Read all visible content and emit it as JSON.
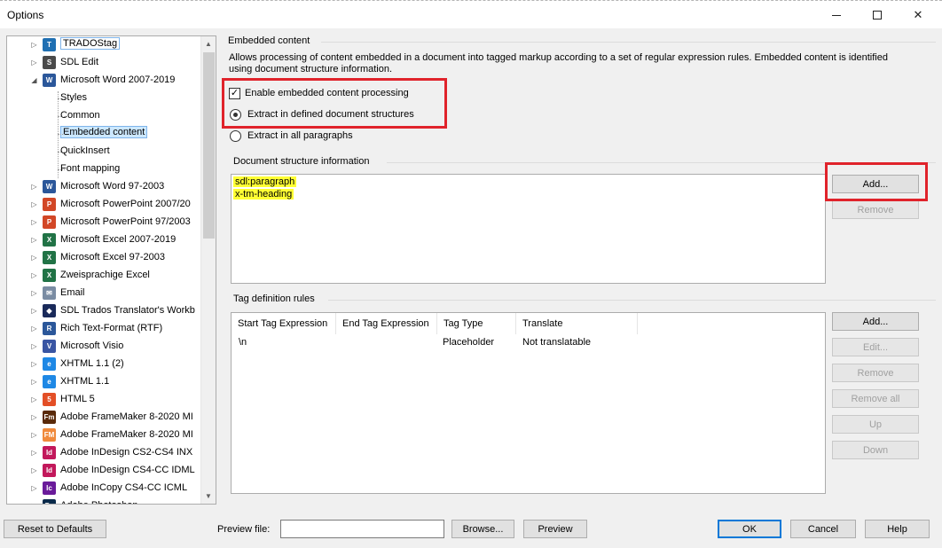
{
  "window": {
    "title": "Options",
    "minimize": "–",
    "maximize": "□",
    "close": "✕"
  },
  "tree": {
    "items": [
      {
        "label": "TRADOStag",
        "icon": "tradostag-icon",
        "icon_text": "T",
        "icon_color": "#1f6fb2",
        "level": 1,
        "expander": "▷"
      },
      {
        "label": "SDL Edit",
        "icon": "sdl-edit-icon",
        "icon_text": "S",
        "icon_color": "#4a4a4a",
        "level": 1,
        "expander": "▷"
      },
      {
        "label": "Microsoft Word 2007-2019",
        "icon": "word-icon",
        "icon_text": "W",
        "icon_color": "#2b579a",
        "level": 1,
        "expander": "◢"
      },
      {
        "label": "Styles",
        "level": 2
      },
      {
        "label": "Common",
        "level": 2
      },
      {
        "label": "Embedded content",
        "level": 2
      },
      {
        "label": "QuickInsert",
        "level": 2
      },
      {
        "label": "Font mapping",
        "level": 2
      },
      {
        "label": "Microsoft Word 97-2003",
        "icon": "word-icon",
        "icon_text": "W",
        "icon_color": "#2b579a",
        "level": 1,
        "expander": "▷"
      },
      {
        "label": "Microsoft PowerPoint 2007/20",
        "icon": "powerpoint-icon",
        "icon_text": "P",
        "icon_color": "#d24726",
        "level": 1,
        "expander": "▷"
      },
      {
        "label": "Microsoft PowerPoint 97/2003",
        "icon": "powerpoint-icon",
        "icon_text": "P",
        "icon_color": "#d24726",
        "level": 1,
        "expander": "▷"
      },
      {
        "label": "Microsoft Excel 2007-2019",
        "icon": "excel-icon",
        "icon_text": "X",
        "icon_color": "#217346",
        "level": 1,
        "expander": "▷"
      },
      {
        "label": "Microsoft Excel 97-2003",
        "icon": "excel-icon",
        "icon_text": "X",
        "icon_color": "#217346",
        "level": 1,
        "expander": "▷"
      },
      {
        "label": "Zweisprachige Excel",
        "icon": "excel-icon",
        "icon_text": "X",
        "icon_color": "#217346",
        "level": 1,
        "expander": "▷"
      },
      {
        "label": "Email",
        "icon": "email-icon",
        "icon_text": "✉",
        "icon_color": "#7a8ca3",
        "level": 1,
        "expander": "▷"
      },
      {
        "label": "SDL Trados Translator's Workb",
        "icon": "trados-workbench-icon",
        "icon_text": "◆",
        "icon_color": "#1a2a5a",
        "level": 1,
        "expander": "▷"
      },
      {
        "label": "Rich Text-Format (RTF)",
        "icon": "rtf-icon",
        "icon_text": "R",
        "icon_color": "#2b579a",
        "level": 1,
        "expander": "▷"
      },
      {
        "label": "Microsoft Visio",
        "icon": "visio-icon",
        "icon_text": "V",
        "icon_color": "#3955a3",
        "level": 1,
        "expander": "▷"
      },
      {
        "label": "XHTML 1.1 (2)",
        "icon": "xhtml-icon",
        "icon_text": "e",
        "icon_color": "#1e88e5",
        "level": 1,
        "expander": "▷"
      },
      {
        "label": "XHTML 1.1",
        "icon": "xhtml-icon",
        "icon_text": "e",
        "icon_color": "#1e88e5",
        "level": 1,
        "expander": "▷"
      },
      {
        "label": "HTML 5",
        "icon": "html5-icon",
        "icon_text": "5",
        "icon_color": "#e34f26",
        "level": 1,
        "expander": "▷"
      },
      {
        "label": "Adobe FrameMaker 8-2020 MI",
        "icon": "framemaker-icon",
        "icon_text": "Fm",
        "icon_color": "#5a2a0a",
        "level": 1,
        "expander": "▷"
      },
      {
        "label": "Adobe FrameMaker 8-2020 MI",
        "icon": "framemaker-icon",
        "icon_text": "FM",
        "icon_color": "#f08a3c",
        "level": 1,
        "expander": "▷"
      },
      {
        "label": "Adobe InDesign CS2-CS4 INX",
        "icon": "indesign-icon",
        "icon_text": "Id",
        "icon_color": "#c2185b",
        "level": 1,
        "expander": "▷"
      },
      {
        "label": "Adobe InDesign CS4-CC IDML",
        "icon": "indesign-icon",
        "icon_text": "Id",
        "icon_color": "#c2185b",
        "level": 1,
        "expander": "▷"
      },
      {
        "label": "Adobe InCopy CS4-CC ICML",
        "icon": "incopy-icon",
        "icon_text": "Ic",
        "icon_color": "#6a1b9a",
        "level": 1,
        "expander": "▷"
      },
      {
        "label": "Adobe Photoshop",
        "icon": "photoshop-icon",
        "icon_text": "Ps",
        "icon_color": "#0a2a4a",
        "level": 1,
        "expander": "▷"
      }
    ]
  },
  "embedded": {
    "section_title": "Embedded content",
    "description": "Allows processing of content embedded in a document into tagged markup according to a set of regular expression rules. Embedded content is identified using document structure information.",
    "enable_label": "Enable embedded content processing",
    "enable_checked": "✓",
    "extract_defined_label": "Extract in defined document structures",
    "extract_all_label": "Extract in all paragraphs"
  },
  "doc_structure": {
    "section_title": "Document structure information",
    "items": [
      "sdl:paragraph",
      "x-tm-heading"
    ],
    "add_label": "Add...",
    "remove_label": "Remove"
  },
  "tag_rules": {
    "section_title": "Tag definition rules",
    "columns": [
      "Start Tag Expression",
      "End Tag Expression",
      "Tag Type",
      "Translate"
    ],
    "rows": [
      [
        "\\n",
        "",
        "Placeholder",
        "Not translatable"
      ]
    ],
    "add_label": "Add...",
    "edit_label": "Edit...",
    "remove_label": "Remove",
    "remove_all_label": "Remove all",
    "up_label": "Up",
    "down_label": "Down"
  },
  "footer": {
    "reset_label": "Reset to Defaults",
    "preview_file_label": "Preview file:",
    "preview_file_value": "",
    "browse_label": "Browse...",
    "preview_label": "Preview",
    "ok_label": "OK",
    "cancel_label": "Cancel",
    "help_label": "Help"
  },
  "colors": {
    "highlight_red": "#e0232b",
    "highlight_yellow": "#ffff33",
    "selection": "#cce8ff"
  }
}
